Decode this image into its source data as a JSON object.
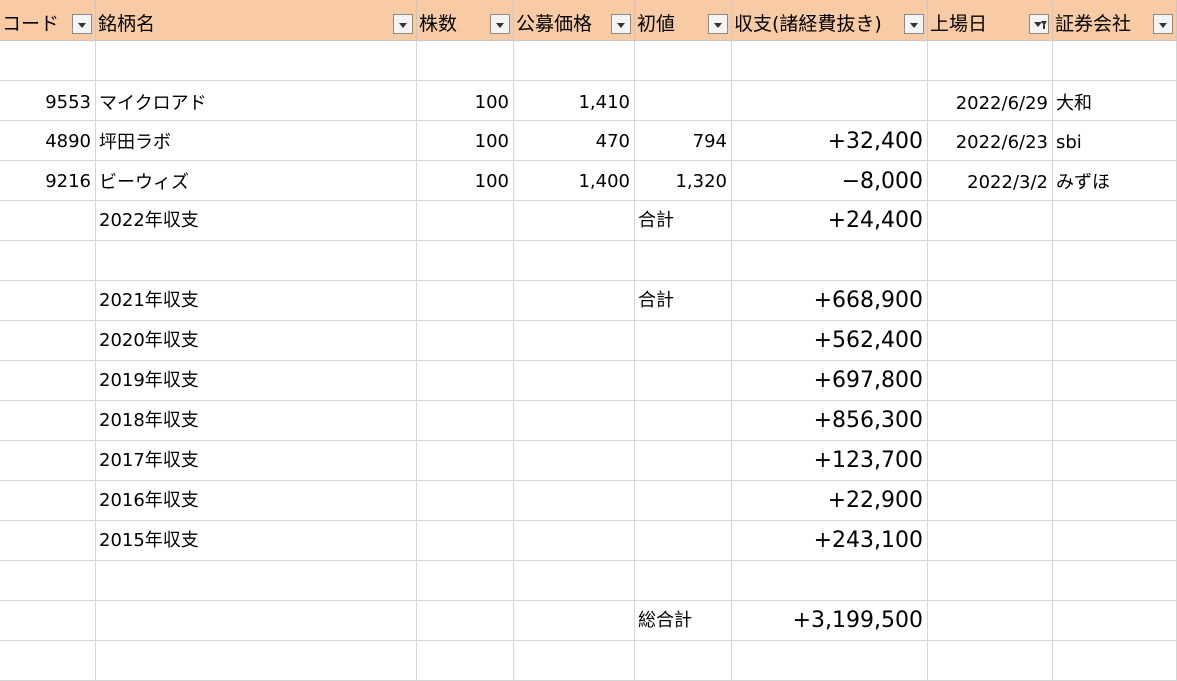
{
  "columns": [
    {
      "key": "code",
      "label": "コード"
    },
    {
      "key": "name",
      "label": "銘柄名"
    },
    {
      "key": "shares",
      "label": "株数"
    },
    {
      "key": "offer_price",
      "label": "公募価格"
    },
    {
      "key": "first_price",
      "label": "初値"
    },
    {
      "key": "pnl",
      "label": "収支(諸経費抜き)"
    },
    {
      "key": "listing_date",
      "label": "上場日",
      "filtered": true
    },
    {
      "key": "broker",
      "label": "証券会社"
    }
  ],
  "rows": [
    {},
    {
      "code": "9553",
      "name": "マイクロアド",
      "shares": "100",
      "offer_price": "1,410",
      "first_price": "",
      "pnl": "",
      "listing_date": "2022/6/29",
      "broker": "大和"
    },
    {
      "code": "4890",
      "name": "坪田ラボ",
      "shares": "100",
      "offer_price": "470",
      "first_price": "794",
      "pnl": "+32,400",
      "listing_date": "2022/6/23",
      "broker": "sbi"
    },
    {
      "code": "9216",
      "name": "ビーウィズ",
      "shares": "100",
      "offer_price": "1,400",
      "first_price": "1,320",
      "pnl": "−8,000",
      "listing_date": "2022/3/2",
      "broker": "みずほ"
    },
    {
      "name": "2022年収支",
      "first_price": "合計",
      "pnl": "+24,400"
    },
    {},
    {
      "name": "2021年収支",
      "first_price": "合計",
      "pnl": "+668,900"
    },
    {
      "name": "2020年収支",
      "pnl": "+562,400"
    },
    {
      "name": "2019年収支",
      "pnl": "+697,800"
    },
    {
      "name": "2018年収支",
      "pnl": "+856,300"
    },
    {
      "name": "2017年収支",
      "pnl": "+123,700"
    },
    {
      "name": "2016年収支",
      "pnl": "+22,900"
    },
    {
      "name": "2015年収支",
      "pnl": "+243,100"
    },
    {},
    {
      "first_price": "総合計",
      "pnl": "+3,199,500"
    },
    {}
  ],
  "filter_button_icon": "dropdown-arrow-icon",
  "filtered_button_icon": "filter-funnel-icon",
  "colors": {
    "header_bg": "#f8cba4",
    "gridline": "#d4d4d4"
  }
}
